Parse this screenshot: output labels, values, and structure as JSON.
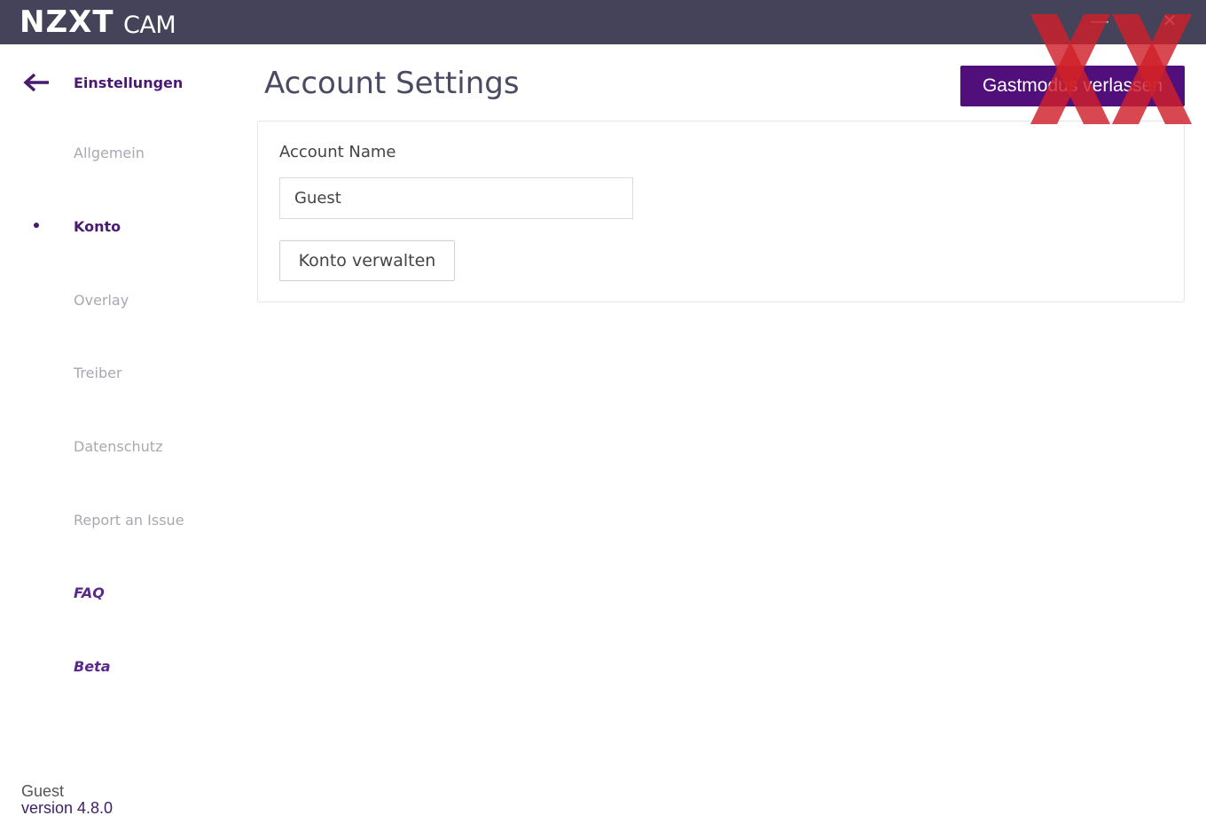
{
  "app": {
    "brand": "NZXT",
    "product": "CAM"
  },
  "window_controls": {
    "minimize_icon": "minimize-icon",
    "close_icon": "close-icon"
  },
  "sidebar": {
    "back_icon": "arrow-left-icon",
    "heading": "Einstellungen",
    "items": [
      {
        "label": "Allgemein",
        "state": "inactive"
      },
      {
        "label": "Konto",
        "state": "active"
      },
      {
        "label": "Overlay",
        "state": "inactive"
      },
      {
        "label": "Treiber",
        "state": "inactive"
      },
      {
        "label": "Datenschutz",
        "state": "inactive"
      },
      {
        "label": "Report an Issue",
        "state": "inactive"
      },
      {
        "label": "FAQ",
        "state": "link"
      },
      {
        "label": "Beta",
        "state": "link"
      }
    ],
    "footer": {
      "user": "Guest",
      "version": "version 4.8.0"
    }
  },
  "main": {
    "title": "Account Settings",
    "leave_guest_button": "Gastmodus verlassen",
    "card": {
      "account_name_label": "Account Name",
      "account_name_value": "Guest",
      "manage_account_button": "Konto verwalten"
    }
  },
  "colors": {
    "titlebar": "#44435a",
    "accent": "#500f7a",
    "watermark": "#d0202a"
  }
}
